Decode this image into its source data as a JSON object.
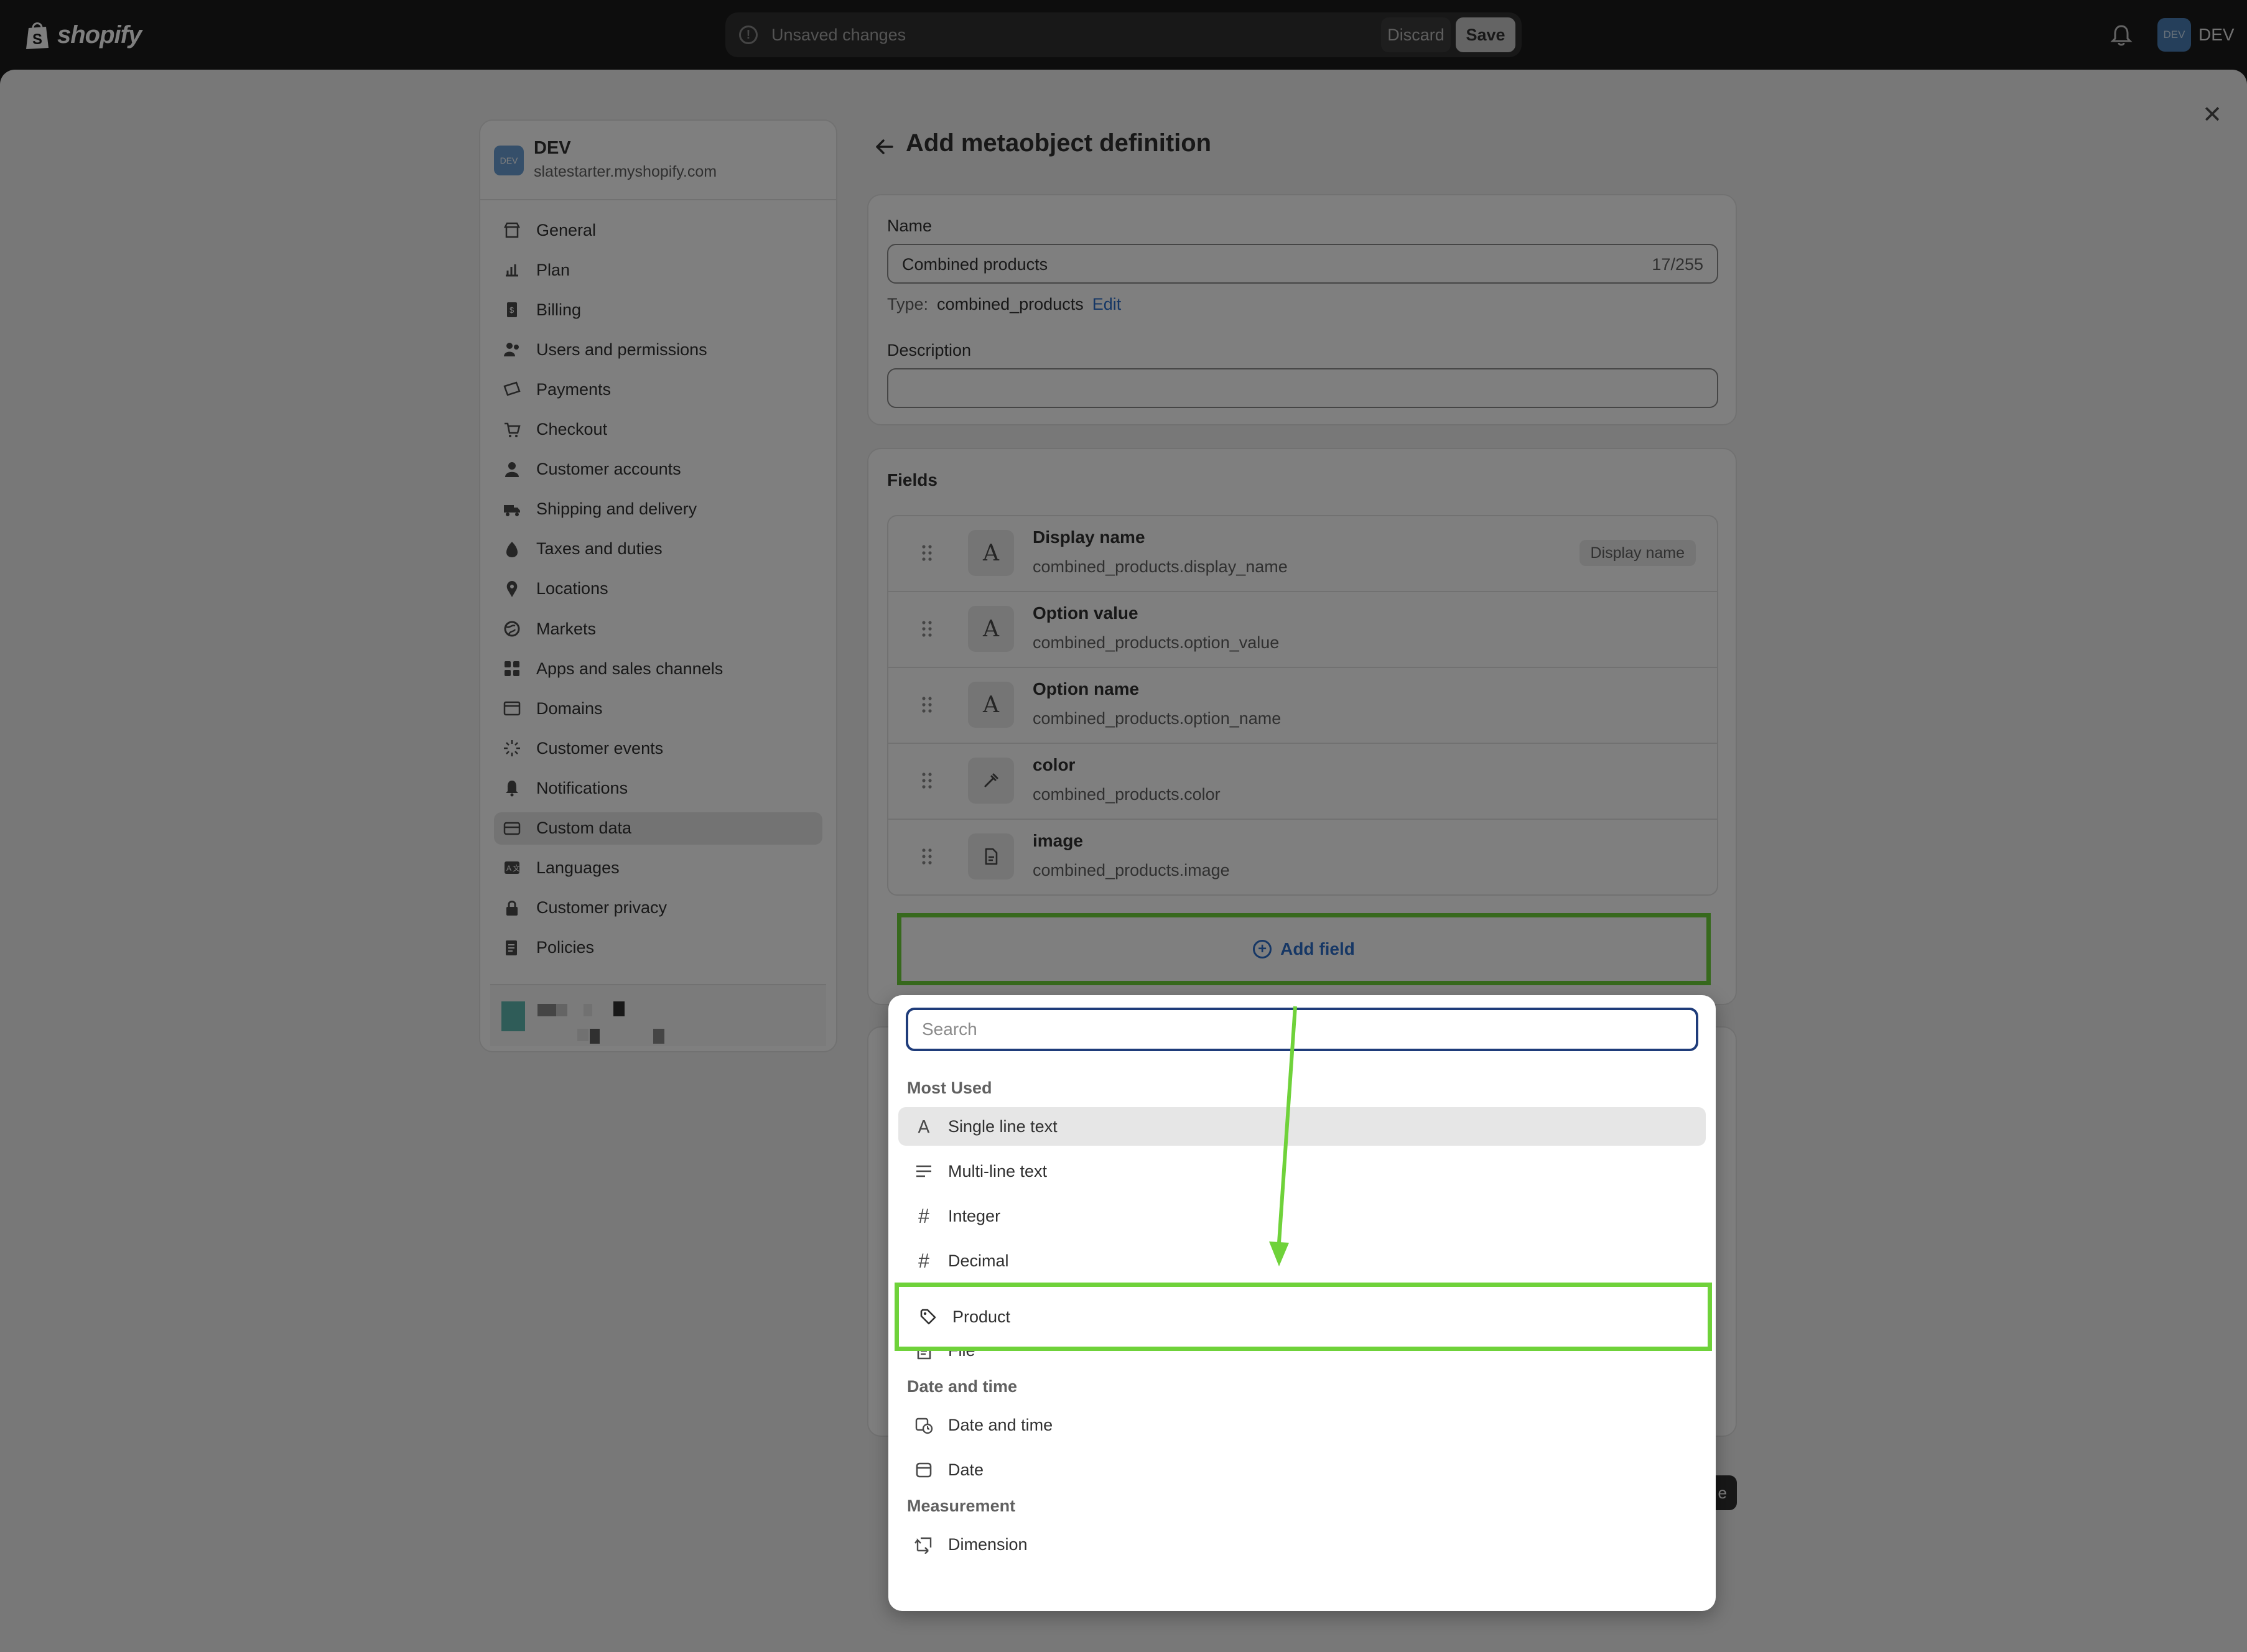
{
  "topbar": {
    "logo_text": "shopify",
    "unsaved_message": "Unsaved changes",
    "discard_label": "Discard",
    "save_label": "Save",
    "account_initials": "DEV",
    "account_name": "DEV"
  },
  "sidebar": {
    "store_initials": "DEV",
    "store_name": "DEV",
    "store_url": "slatestarter.myshopify.com",
    "items": [
      {
        "label": "General",
        "icon": "store-icon"
      },
      {
        "label": "Plan",
        "icon": "plan-icon"
      },
      {
        "label": "Billing",
        "icon": "billing-icon"
      },
      {
        "label": "Users and permissions",
        "icon": "users-icon"
      },
      {
        "label": "Payments",
        "icon": "payments-icon"
      },
      {
        "label": "Checkout",
        "icon": "cart-icon"
      },
      {
        "label": "Customer accounts",
        "icon": "person-icon"
      },
      {
        "label": "Shipping and delivery",
        "icon": "truck-icon"
      },
      {
        "label": "Taxes and duties",
        "icon": "tax-icon"
      },
      {
        "label": "Locations",
        "icon": "location-icon"
      },
      {
        "label": "Markets",
        "icon": "globe-icon"
      },
      {
        "label": "Apps and sales channels",
        "icon": "apps-icon"
      },
      {
        "label": "Domains",
        "icon": "domains-icon"
      },
      {
        "label": "Customer events",
        "icon": "events-icon"
      },
      {
        "label": "Notifications",
        "icon": "bell-icon"
      },
      {
        "label": "Custom data",
        "icon": "custom-data-icon"
      },
      {
        "label": "Languages",
        "icon": "languages-icon"
      },
      {
        "label": "Customer privacy",
        "icon": "lock-icon"
      },
      {
        "label": "Policies",
        "icon": "policies-icon"
      }
    ],
    "active_item": "Custom data"
  },
  "main": {
    "title": "Add metaobject definition",
    "name_label": "Name",
    "name_value": "Combined products",
    "name_counter": "17/255",
    "type_label": "Type:",
    "type_value": "combined_products",
    "type_edit": "Edit",
    "description_label": "Description",
    "description_value": "",
    "fields_title": "Fields",
    "fields": [
      {
        "name": "Display name",
        "key": "combined_products.display_name",
        "icon": "text-icon",
        "badge": "Display name"
      },
      {
        "name": "Option value",
        "key": "combined_products.option_value",
        "icon": "text-icon",
        "badge": ""
      },
      {
        "name": "Option name",
        "key": "combined_products.option_name",
        "icon": "text-icon",
        "badge": ""
      },
      {
        "name": "color",
        "key": "combined_products.color",
        "icon": "eyedropper-icon",
        "badge": ""
      },
      {
        "name": "image",
        "key": "combined_products.image",
        "icon": "file-icon",
        "badge": ""
      }
    ],
    "add_field_label": "Add field"
  },
  "dropdown": {
    "search_placeholder": "Search",
    "groups": [
      {
        "title": "Most Used",
        "items": [
          "Single line text",
          "Multi-line text",
          "Integer",
          "Decimal",
          "Product",
          "File"
        ]
      },
      {
        "title": "Date and time",
        "items": [
          "Date and time",
          "Date"
        ]
      },
      {
        "title": "Measurement",
        "items": [
          "Dimension"
        ]
      }
    ],
    "hovered_item": "Single line text",
    "highlighted_item": "Product"
  },
  "colors": {
    "highlight": "#6fd23a",
    "link": "#2c6ecb",
    "topbar": "#1a1a1a"
  }
}
